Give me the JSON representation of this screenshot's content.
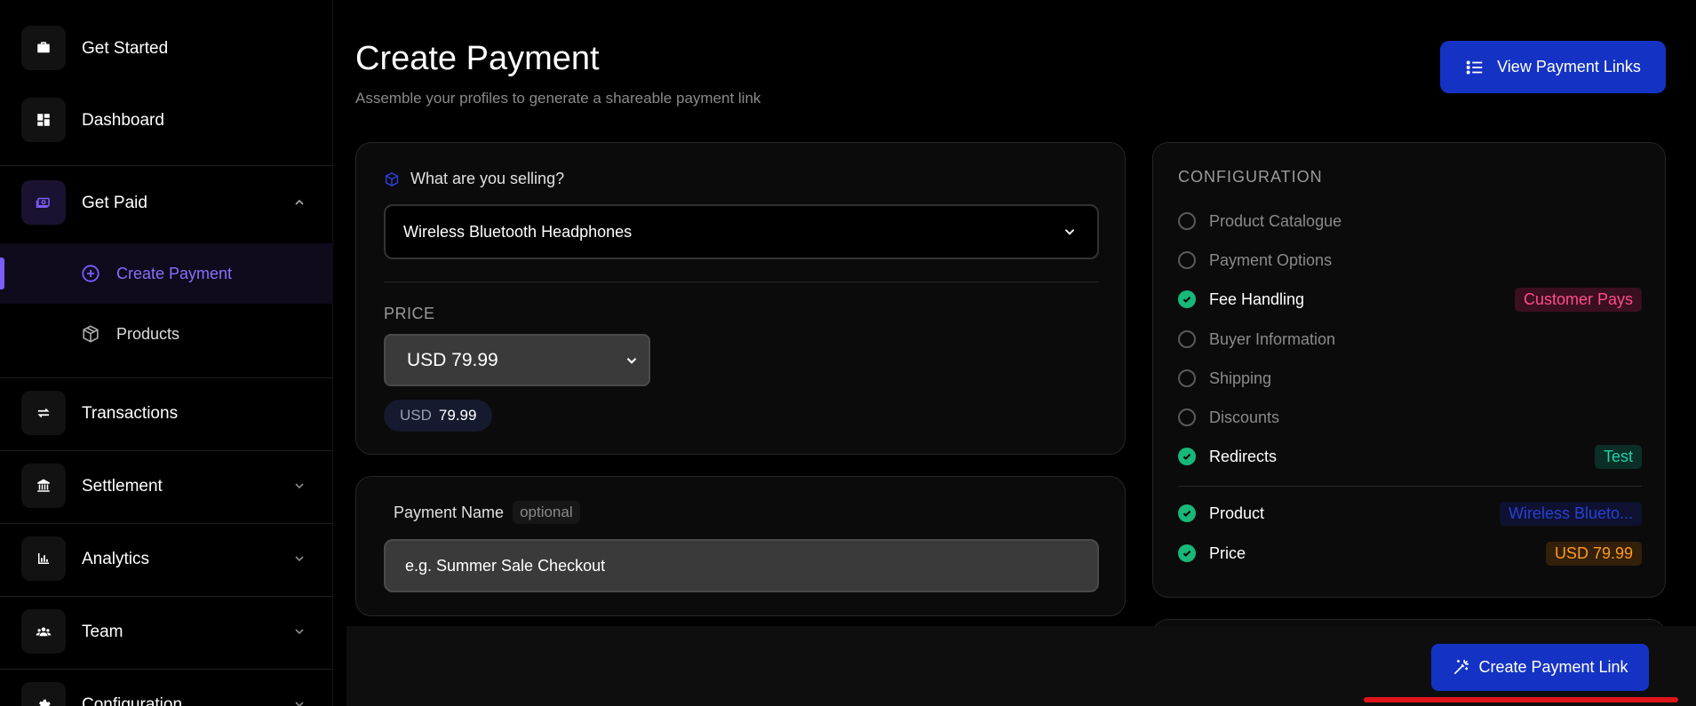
{
  "sidebar": {
    "items": [
      {
        "label": "Get Started",
        "icon": "briefcase-icon"
      },
      {
        "label": "Dashboard",
        "icon": "dashboard-icon"
      },
      {
        "label": "Get Paid",
        "icon": "money-icon"
      },
      {
        "label": "Transactions",
        "icon": "transfer-icon"
      },
      {
        "label": "Settlement",
        "icon": "bank-icon"
      },
      {
        "label": "Analytics",
        "icon": "bar-chart-icon"
      },
      {
        "label": "Team",
        "icon": "team-icon"
      },
      {
        "label": "Configuration",
        "icon": "gear-icon"
      }
    ],
    "sub_items": [
      {
        "label": "Create Payment",
        "icon": "plus-circle-icon",
        "active": true
      },
      {
        "label": "Products",
        "icon": "box-icon",
        "active": false
      }
    ],
    "accent": "#7c5cff"
  },
  "header": {
    "title": "Create Payment",
    "subtitle": "Assemble your profiles to generate a shareable payment link",
    "view_links_label": "View Payment Links"
  },
  "selling": {
    "question": "What are you selling?",
    "selected_product": "Wireless Bluetooth Headphones"
  },
  "price": {
    "label": "PRICE",
    "selected": "USD 79.99",
    "pill_currency": "USD",
    "pill_amount": "79.99"
  },
  "payment_name": {
    "label": "Payment Name",
    "optional": "optional",
    "placeholder": "e.g. Summer Sale Checkout"
  },
  "config": {
    "title": "CONFIGURATION",
    "items": [
      {
        "label": "Product Catalogue",
        "done": false
      },
      {
        "label": "Payment Options",
        "done": false
      },
      {
        "label": "Fee Handling",
        "done": true,
        "badge": "Customer Pays"
      },
      {
        "label": "Buyer Information",
        "done": false
      },
      {
        "label": "Shipping",
        "done": false
      },
      {
        "label": "Discounts",
        "done": false
      },
      {
        "label": "Redirects",
        "done": true,
        "badge": "Test"
      }
    ],
    "summary": [
      {
        "label": "Product",
        "done": true,
        "badge": "Wireless Blueto..."
      },
      {
        "label": "Price",
        "done": true,
        "badge": "USD 79.99"
      }
    ],
    "colors": {
      "check": "#17b87a",
      "pink": "#ff4d8d",
      "teal": "#1fd4a8",
      "blue": "#2a3fd6",
      "orange": "#ff9a1f"
    }
  },
  "footer": {
    "create_label": "Create Payment Link",
    "button_color": "#1433c4"
  }
}
